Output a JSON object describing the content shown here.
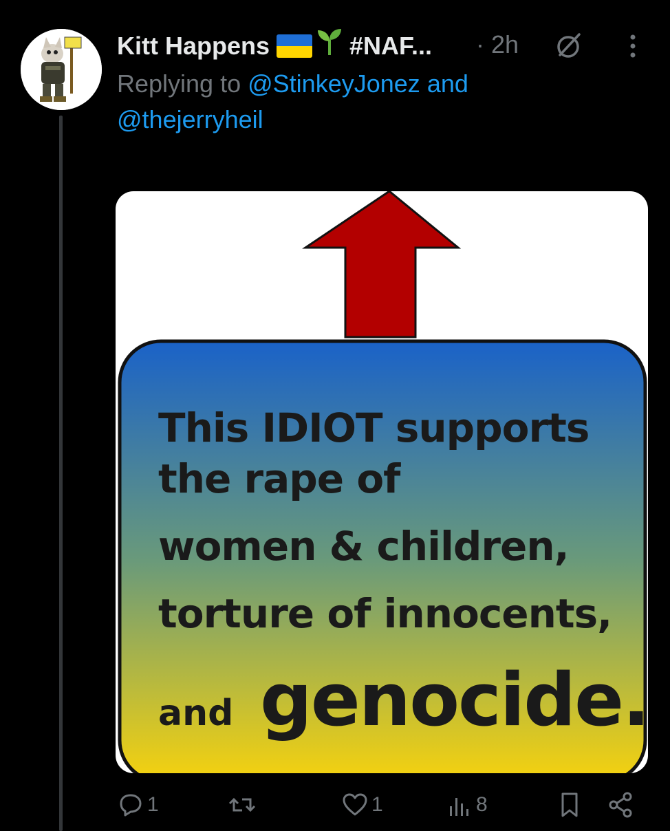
{
  "tweet": {
    "author_name": "Kitt Happens",
    "handle_truncated": "#NAF...",
    "dot": "·",
    "time": "2h",
    "replying_to_prefix": "Replying to",
    "mention_1": "@StinkeyJonez",
    "and": "and",
    "mention_2": "@thejerryheil"
  },
  "media": {
    "line1": "This IDIOT supports",
    "line2": "the rape of",
    "line3": "women & children,",
    "line4": "torture of innocents,",
    "line5_small": "and",
    "line5_big": "genocide."
  },
  "actions": {
    "reply_count": "1",
    "repost_count": "",
    "like_count": "1",
    "views_count": "8"
  },
  "colors": {
    "background": "#000000",
    "text": "#e7e9ea",
    "muted": "#71767b",
    "link": "#1d9bf0",
    "arrow_red": "#b30000",
    "gradient_top": "#1a62c8",
    "gradient_bottom": "#f6d20e"
  }
}
